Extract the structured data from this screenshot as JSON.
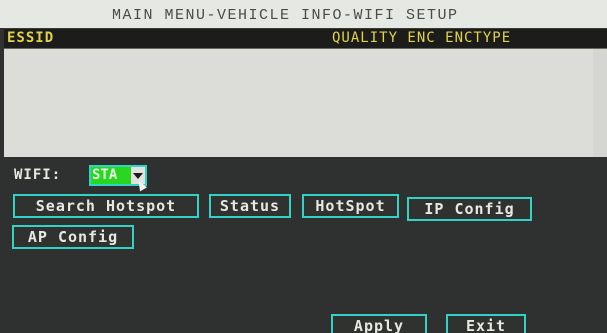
{
  "title": "MAIN MENU-VEHICLE INFO-WIFI SETUP",
  "list": {
    "col_essid": "ESSID",
    "col_right": "QUALITY ENC ENCTYPE"
  },
  "wifi": {
    "label": "WIFI:",
    "mode_value": "STA"
  },
  "buttons": {
    "search_hotspot": "Search Hotspot",
    "status": "Status",
    "hotspot": "HotSpot",
    "ip_config": "IP Config",
    "ap_config": "AP Config",
    "apply": "Apply",
    "exit": "Exit"
  },
  "colors": {
    "header_text": "#e0d34a",
    "button_border": "#33d2c6",
    "select_fill": "#27d81f",
    "background": "#2f3130"
  }
}
